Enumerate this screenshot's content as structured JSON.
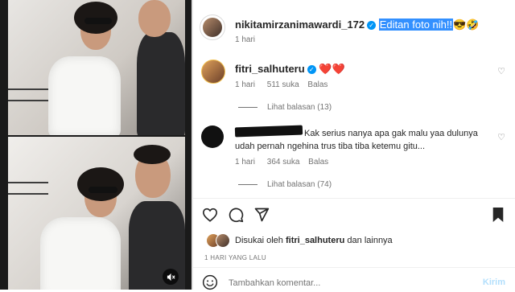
{
  "post": {
    "author": "nikitamirzanimawardi_172",
    "caption_highlight": "Editan foto nih!!",
    "caption_emojis": "😎🤣",
    "time": "1 hari"
  },
  "comments": [
    {
      "username": "fitri_salhuteru",
      "text_emojis": "❤️❤️",
      "time": "1 hari",
      "likes": "511 suka",
      "reply": "Balas",
      "view_replies": "Lihat balasan (13)"
    },
    {
      "username": "",
      "text_line1": "Kak serius nanya apa gak malu yaa dulunya",
      "text_line2": "udah pernah ngehina trus tiba tiba ketemu gitu...",
      "time": "1 hari",
      "likes": "364 suka",
      "reply": "Balas",
      "view_replies": "Lihat balasan (74)"
    }
  ],
  "likes": {
    "prefix": "Disukai oleh",
    "user": "fitri_salhuteru",
    "suffix": "dan lainnya"
  },
  "post_date": "1 HARI YANG LALU",
  "comment_input": {
    "placeholder": "Tambahkan komentar...",
    "submit": "Kirim"
  },
  "colors": {
    "verified": "#0095f6",
    "heart": "#ed4956",
    "highlight": "#3390ff",
    "submit": "#b2dffc"
  },
  "icons": [
    "like-icon",
    "comment-icon",
    "share-icon",
    "save-icon",
    "emoji-icon",
    "mute-icon",
    "more-icon"
  ]
}
